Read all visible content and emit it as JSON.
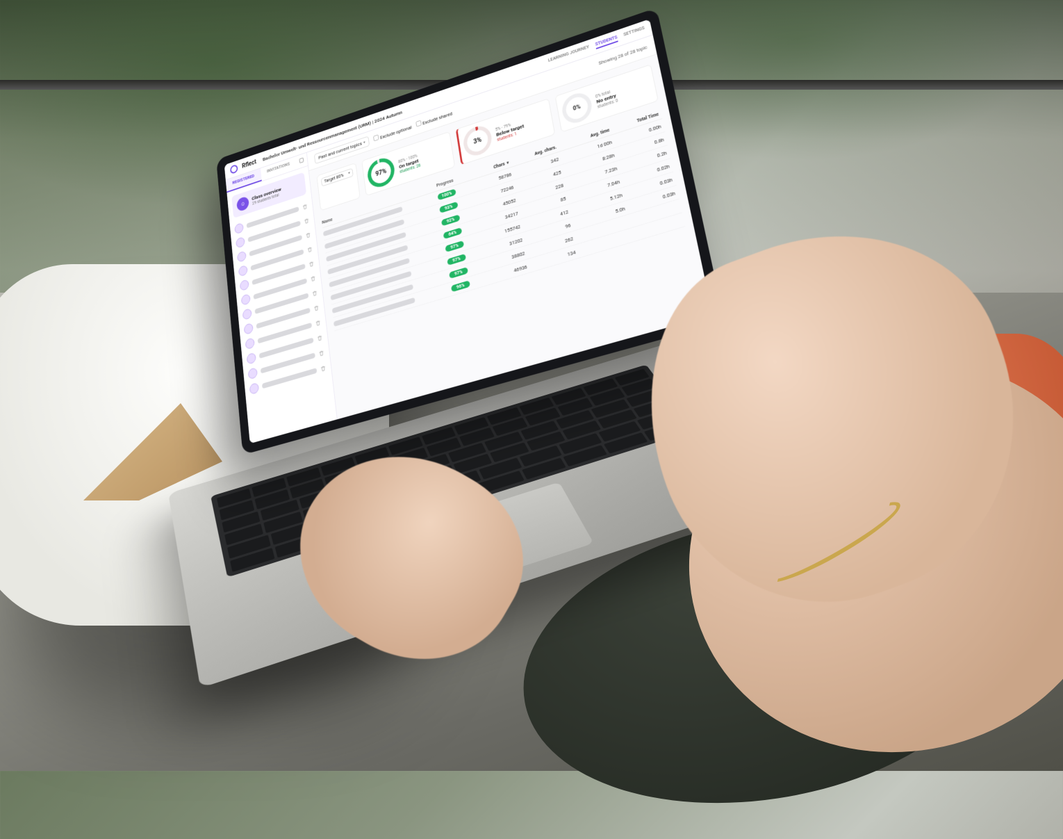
{
  "brand": "Rflect",
  "course_title": "Bachelor Umwelt- und Ressourcenmanagement (URM) | 2024 Autumn",
  "nav": {
    "learning_journey": "LEARNING JOURNEY",
    "students": "STUDENTS",
    "settings": "SETTINGS"
  },
  "sidebar": {
    "tabs": {
      "registered": "REGISTERED",
      "invitations": "INVITATIONS"
    },
    "overview": {
      "title": "Class overview",
      "subtitle": "29 students total"
    },
    "student_count": 12
  },
  "filters": {
    "scope": "Past and current topics",
    "exclude_optional": "Exclude optional",
    "exclude_shared": "Exclude shared",
    "showing": "Showing 28 of 28 topic"
  },
  "target": {
    "label": "Target 80%"
  },
  "summary": {
    "on_target": {
      "range": "80% - 100%",
      "label": "On target",
      "percent": "97%",
      "count": "students: 28"
    },
    "below_target": {
      "range": "5% - 79%",
      "label": "Below target",
      "percent": "3%",
      "count": "students: 1"
    },
    "no_entry": {
      "range": "0% total",
      "label": "No entry",
      "percent": "0%",
      "count": "students: 0"
    }
  },
  "columns": {
    "name": "Name",
    "progress": "Progress",
    "chars": "Chars",
    "avg_chars": "Avg. chars.",
    "avg_time": "Avg. time",
    "total_time": "Total Time"
  },
  "chart_data": {
    "type": "table",
    "rows": [
      {
        "progress": "100%",
        "chars": "58786",
        "avg_chars": "342",
        "avg_time": "1d 00h",
        "total_time": "0.00h"
      },
      {
        "progress": "93%",
        "chars": "72246",
        "avg_chars": "425",
        "avg_time": "8:28h",
        "total_time": "0.8h"
      },
      {
        "progress": "92%",
        "chars": "45052",
        "avg_chars": "228",
        "avg_time": "7.23h",
        "total_time": "0.2h"
      },
      {
        "progress": "64%",
        "chars": "34217",
        "avg_chars": "85",
        "avg_time": "7.04h",
        "total_time": "0.02h"
      },
      {
        "progress": "97%",
        "chars": "155742",
        "avg_chars": "412",
        "avg_time": "5.12h",
        "total_time": "0.03h"
      },
      {
        "progress": "97%",
        "chars": "31202",
        "avg_chars": "96",
        "avg_time": "5.0h",
        "total_time": "0.03h"
      },
      {
        "progress": "97%",
        "chars": "38802",
        "avg_chars": "262",
        "avg_time": "",
        "total_time": ""
      },
      {
        "progress": "96%",
        "chars": "46936",
        "avg_chars": "134",
        "avg_time": "",
        "total_time": ""
      }
    ]
  }
}
